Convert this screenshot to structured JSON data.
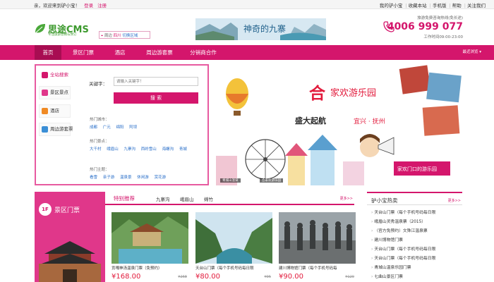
{
  "topbar": {
    "welcome": "亲，欢迎来到驴小宝！",
    "login": "登录",
    "register": "注册",
    "my_lvxiaobao": "我的驴小宝",
    "favorites": "收藏本站",
    "mobile": "手机版",
    "help": "帮助",
    "follow": "关注我们"
  },
  "logo": {
    "name": "思途CMS",
    "slogan": "专注旅游营销与预订"
  },
  "city": {
    "prefix": "周边",
    "current": "四川",
    "switch": "切换区域"
  },
  "hotline": {
    "caption": "旅游免费咨询热线(免长途)",
    "number": "4006 999 077",
    "hours": "工作时间09:00-23:00"
  },
  "header_banner": {
    "text": "神奇的九寨"
  },
  "nav": {
    "items": [
      "首页",
      "景区门票",
      "酒店",
      "周边游套票",
      "分销商合作"
    ],
    "more": "最近浏览"
  },
  "search": {
    "tabs": [
      "全站搜索",
      "景区景点",
      "酒店",
      "周边游套票"
    ],
    "keyword_label": "关键字：",
    "placeholder": "请输入关键字！",
    "button": "搜 索",
    "hot_city_title": "热门城市：",
    "hot_cities": [
      "成都",
      "广元",
      "绵阳",
      "阿坝"
    ],
    "hot_scenic_title": "热门景点：",
    "hot_scenic": [
      "大千村",
      "峨眉山",
      "九寨沟",
      "西岭雪山",
      "海螺沟",
      "青城"
    ],
    "hot_theme_title": "热门主题：",
    "hot_themes": [
      "看雪",
      "亲子游",
      "温泉景",
      "休闲游",
      "赏花游"
    ]
  },
  "hero": {
    "big_char": "合",
    "title": "家欢游乐园",
    "subtitle": "盛大起航",
    "location": "宜兴 · 抚州",
    "cap1": "青城山温泉",
    "cap2": "合家欢游乐园"
  },
  "scenic": {
    "badge": "1F",
    "title": "景区门票",
    "tabs": [
      "特别推荐",
      "九寨沟",
      "峨眉山",
      "绵竹"
    ],
    "more": "更多>>",
    "cards": [
      {
        "title": "贡嘎神汤温泉门票（免预约）",
        "price": "¥168.00",
        "market": "¥268"
      },
      {
        "title": "天台山门票（每个手机号码每日限",
        "price": "¥80.00",
        "market": "¥95"
      },
      {
        "title": "建川博物馆门票（每个手机号码每",
        "price": "¥90.00",
        "market": "¥120"
      }
    ]
  },
  "hot_sales": {
    "title": "驴小宝热卖",
    "more": "更多>>",
    "items": [
      "天台山门票（每个手机号码每日限",
      "峨眉山灵秀温泉票（2015）",
      "（官方免预约）文殊江温泉票",
      "建川博物馆门票",
      "天台山门票（每个手机号码每日限",
      "天台山门票（每个手机号码每日限",
      "青城山温泉乐园门票",
      "七曲山景区门票"
    ]
  },
  "colors": {
    "brand": "#d4166c",
    "brand_dark": "#a80d52",
    "price": "#e21b3c",
    "link": "#2a6fc9"
  }
}
